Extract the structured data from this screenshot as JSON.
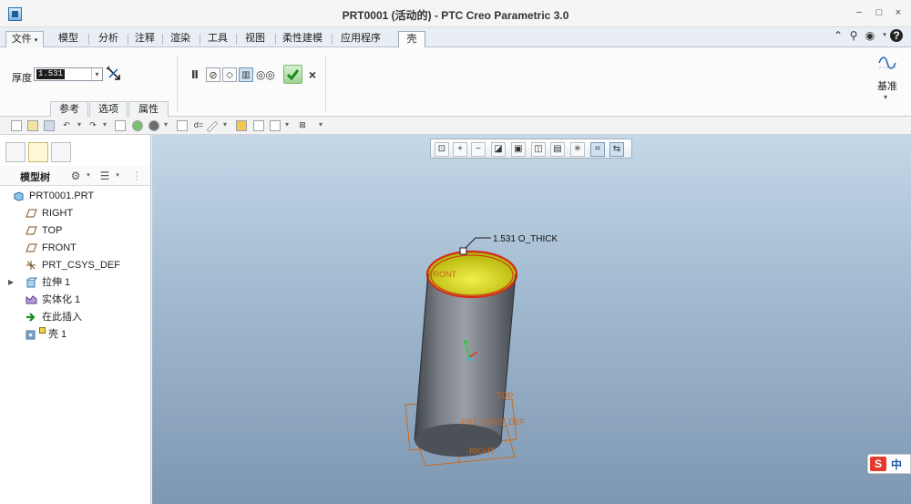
{
  "window": {
    "title": "PRT0001 (活动的) - PTC Creo Parametric 3.0",
    "controls": [
      "−",
      "□",
      "×"
    ]
  },
  "ribbon_tabs": [
    {
      "label": "文件",
      "has_dropdown": true
    },
    {
      "label": "模型"
    },
    {
      "label": "分析"
    },
    {
      "label": "注释"
    },
    {
      "label": "渲染"
    },
    {
      "label": "工具"
    },
    {
      "label": "视图"
    },
    {
      "label": "柔性建模"
    },
    {
      "label": "应用程序"
    },
    {
      "label": "壳",
      "active": true
    }
  ],
  "shell_feature": {
    "thickness_label": "厚度",
    "thickness_value": "1.531",
    "sub_tabs": [
      "参考",
      "选项",
      "属性"
    ],
    "datum_label": "基准"
  },
  "model_tree": {
    "title": "模型树",
    "items": [
      {
        "label": "PRT0001.PRT",
        "icon": "part-icon"
      },
      {
        "label": "RIGHT",
        "icon": "datum-plane-icon"
      },
      {
        "label": "TOP",
        "icon": "datum-plane-icon"
      },
      {
        "label": "FRONT",
        "icon": "datum-plane-icon"
      },
      {
        "label": "PRT_CSYS_DEF",
        "icon": "csys-icon"
      },
      {
        "label": "拉伸 1",
        "icon": "extrude-icon",
        "expandable": true
      },
      {
        "label": "实体化 1",
        "icon": "solidify-icon"
      },
      {
        "label": "在此插入",
        "icon": "insert-here-icon"
      },
      {
        "label": "壳 1",
        "icon": "shell-icon"
      }
    ]
  },
  "graphics": {
    "dimension_label": "1.531 O_THICK",
    "datum_labels": {
      "front": "FRONT",
      "top": "TOP",
      "right": "RIGHT",
      "csys": "PRT_CSYS_DEF"
    }
  },
  "ime": {
    "logo": "S",
    "mode": "中"
  },
  "colors": {
    "ribbon_bg": "#fbfbfb",
    "graphics_top": "#c3d8e8",
    "graphics_bottom": "#7e97b2",
    "shell_inner": "#e3e327",
    "shell_edge": "#d42a1a",
    "datum_orange": "#c86a1e",
    "ok_green": "#2f9a2a"
  }
}
